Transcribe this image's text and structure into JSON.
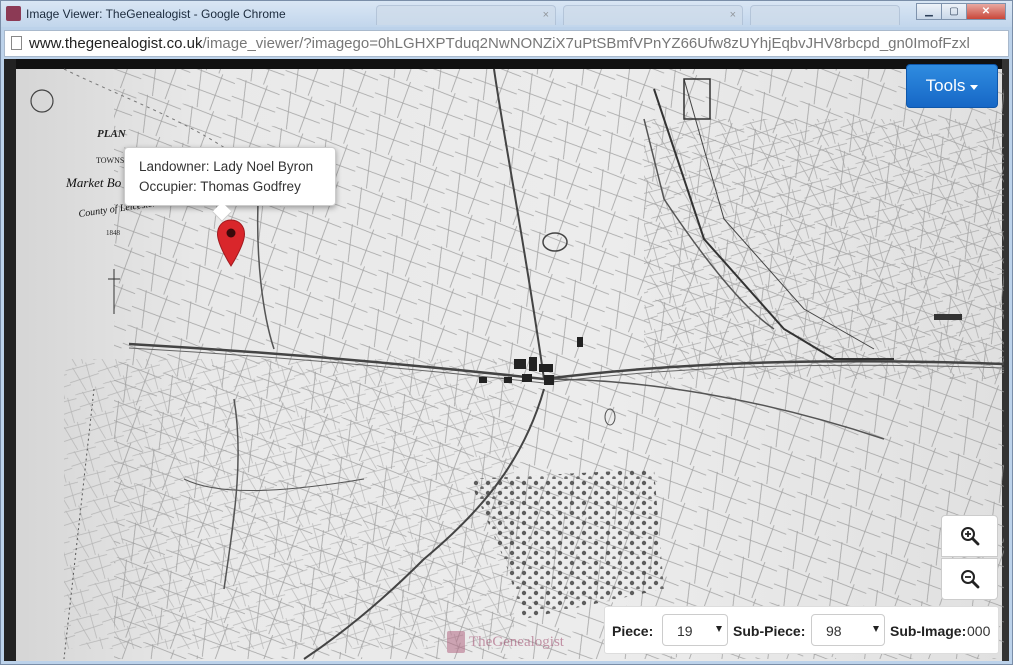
{
  "window": {
    "title": "Image Viewer: TheGenealogist - Google Chrome",
    "min_icon": "minimize-icon",
    "max_icon": "maximize-icon",
    "close_icon": "close-icon"
  },
  "address": {
    "domain": "www.thegenealogist.co.uk",
    "path": "/image_viewer/?imagego=0hLGHXPTduq2NwNONZiX7uPtSBmfVPnYZ66Ufw8zUYhjEqbvJHV8rbcpd_gn0ImofFzxl"
  },
  "map": {
    "title_word": "PLAN",
    "township_word": "TOWNSHI",
    "town_word": "Market Bo",
    "county_label": "County of Leicester",
    "year": "1848"
  },
  "toolbar": {
    "tools_label": "Tools"
  },
  "popup": {
    "landowner": "Landowner: Lady Noel Byron",
    "occupier": "Occupier: Thomas Godfrey"
  },
  "zoom": {
    "in_icon": "zoom-in-icon",
    "out_icon": "zoom-out-icon"
  },
  "controls": {
    "piece_label": "Piece:",
    "piece_value": "19",
    "subpiece_label": "Sub-Piece:",
    "subpiece_value": "98",
    "subimage_label": "Sub-Image:",
    "subimage_value": "000"
  },
  "branding": {
    "logo_text": "TheGenealogist"
  },
  "colors": {
    "tools_button": "#1d75d6",
    "marker": "#d9262b",
    "title_bar": "#c9dbee"
  }
}
